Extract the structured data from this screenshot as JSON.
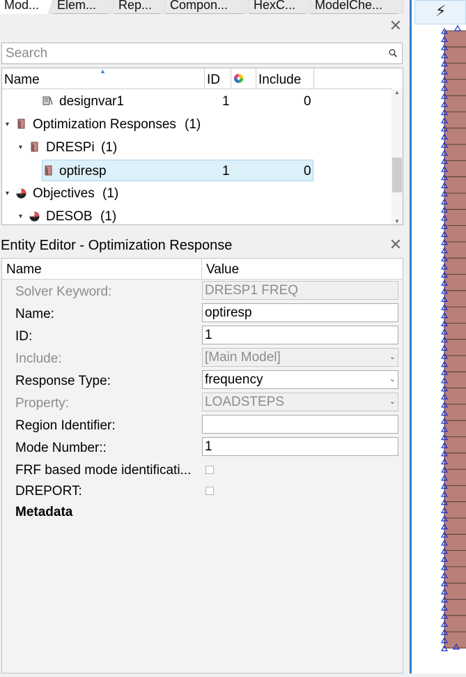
{
  "tabs": [
    "Mod...",
    "Elem...",
    "Rep...",
    "Compon...",
    "HexC...",
    "ModelChe..."
  ],
  "browser": {
    "search_placeholder": "Search",
    "columns": {
      "name": "Name",
      "id": "ID",
      "include": "Include"
    },
    "rows": [
      {
        "label": "designvar1",
        "id": "1",
        "include": "0"
      },
      {
        "label": "Optimization Responses",
        "count": "(1)"
      },
      {
        "label": "DRESPi",
        "count": "(1)"
      },
      {
        "label": "optiresp",
        "id": "1",
        "include": "0"
      },
      {
        "label": "Objectives",
        "count": "(1)"
      },
      {
        "label": "DESOB",
        "count": "(1)"
      }
    ]
  },
  "editor": {
    "title": "Entity Editor - Optimization Response",
    "columns": {
      "name": "Name",
      "value": "Value"
    },
    "rows": [
      {
        "label": "Solver Keyword:",
        "value": "DRESP1  FREQ"
      },
      {
        "label": "Name:",
        "value": "optiresp"
      },
      {
        "label": "ID:",
        "value": "1"
      },
      {
        "label": "Include:",
        "value": "[Main Model]"
      },
      {
        "label": "Response Type:",
        "value": "frequency"
      },
      {
        "label": "Property:",
        "value": "LOADSTEPS"
      },
      {
        "label": "Region Identifier:",
        "value": ""
      },
      {
        "label": "Mode Number::",
        "value": "1"
      },
      {
        "label": "FRF based mode identificati..."
      },
      {
        "label": "DREPORT:"
      },
      {
        "label": "Metadata"
      }
    ]
  },
  "colors": {
    "selection": "#dcf0fa",
    "accent_divider": "#2f7fc8",
    "mesh_fill": "#b88078",
    "constraint_triangle": "#1f2fd0"
  }
}
